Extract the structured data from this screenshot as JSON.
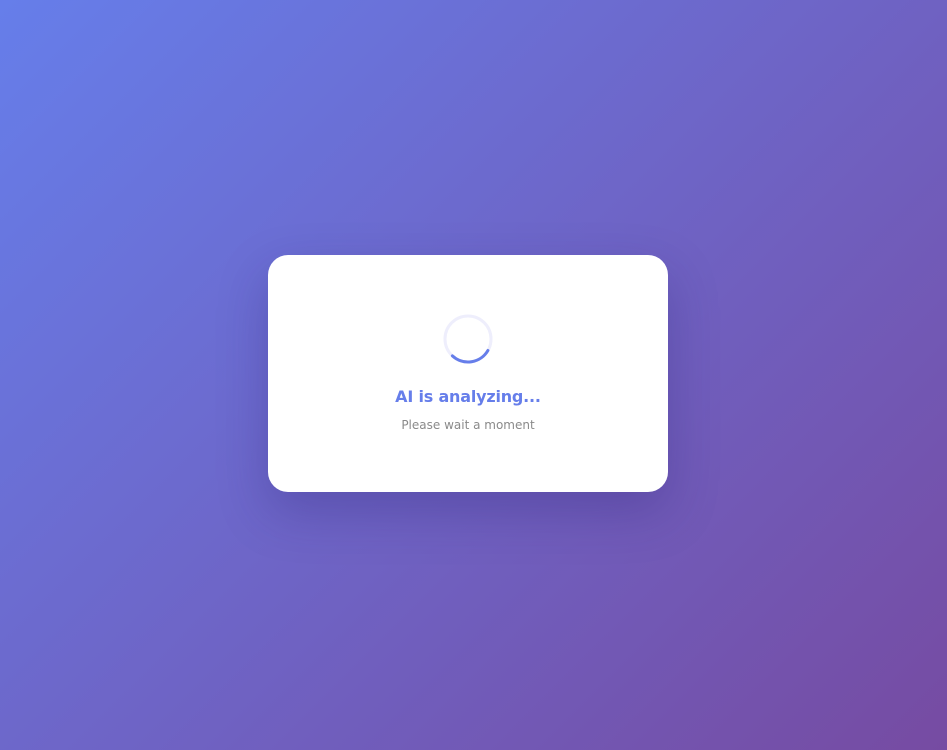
{
  "loading_card": {
    "title": "AI is analyzing...",
    "subtitle": "Please wait a moment",
    "spinner_icon": "loading-spinner-icon"
  },
  "colors": {
    "background_gradient_start": "#667eea",
    "background_gradient_end": "#764ba2",
    "card_background": "#ffffff",
    "accent": "#667eea",
    "spinner_track": "#eeeefc",
    "subtitle_text": "#8a8a8a"
  }
}
